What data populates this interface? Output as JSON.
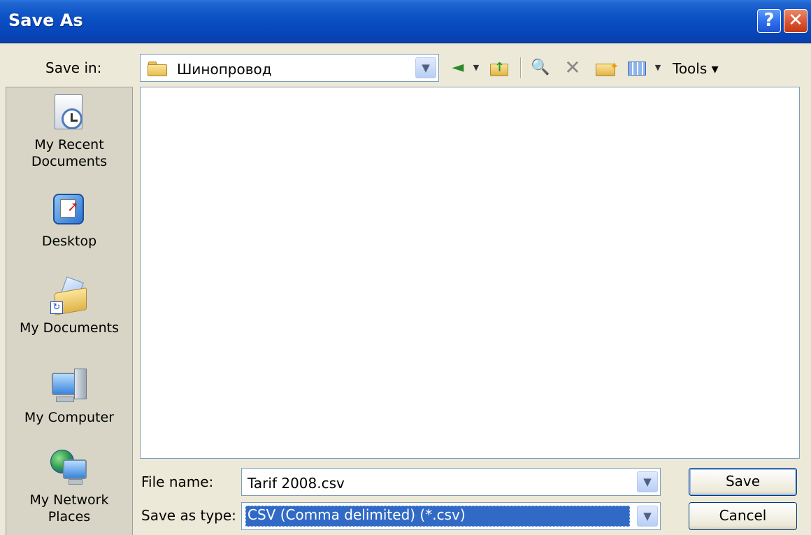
{
  "window": {
    "title": "Save As",
    "help_glyph": "?",
    "close_glyph": "✕"
  },
  "toolbar": {
    "save_in_label": "Save in:",
    "save_in_value": "Шинопровод",
    "tools_label": "Tools ▾",
    "icons": [
      "back-icon",
      "up-folder-icon",
      "search-web-icon",
      "delete-icon",
      "new-folder-icon",
      "views-icon"
    ],
    "back_glyph": "◄",
    "search_glyph": "🔍",
    "delete_glyph": "✕",
    "drop_glyph": "▼"
  },
  "places": [
    {
      "label": "My Recent Documents",
      "icon": "recent-documents-icon"
    },
    {
      "label": "Desktop",
      "icon": "desktop-icon"
    },
    {
      "label": "My Documents",
      "icon": "my-documents-icon"
    },
    {
      "label": "My Computer",
      "icon": "my-computer-icon"
    },
    {
      "label": "My Network Places",
      "icon": "network-places-icon"
    }
  ],
  "form": {
    "file_name_label": "File name:",
    "file_name_value": "Tarif 2008.csv",
    "save_type_label": "Save as type:",
    "save_type_value": "CSV (Comma delimited) (*.csv)",
    "combo_arrow": "▼"
  },
  "buttons": {
    "save": "Save",
    "cancel": "Cancel"
  },
  "colors": {
    "title_bar": "#0a4fc4",
    "selection": "#316ac5",
    "dialog_bg": "#ece9d8"
  }
}
